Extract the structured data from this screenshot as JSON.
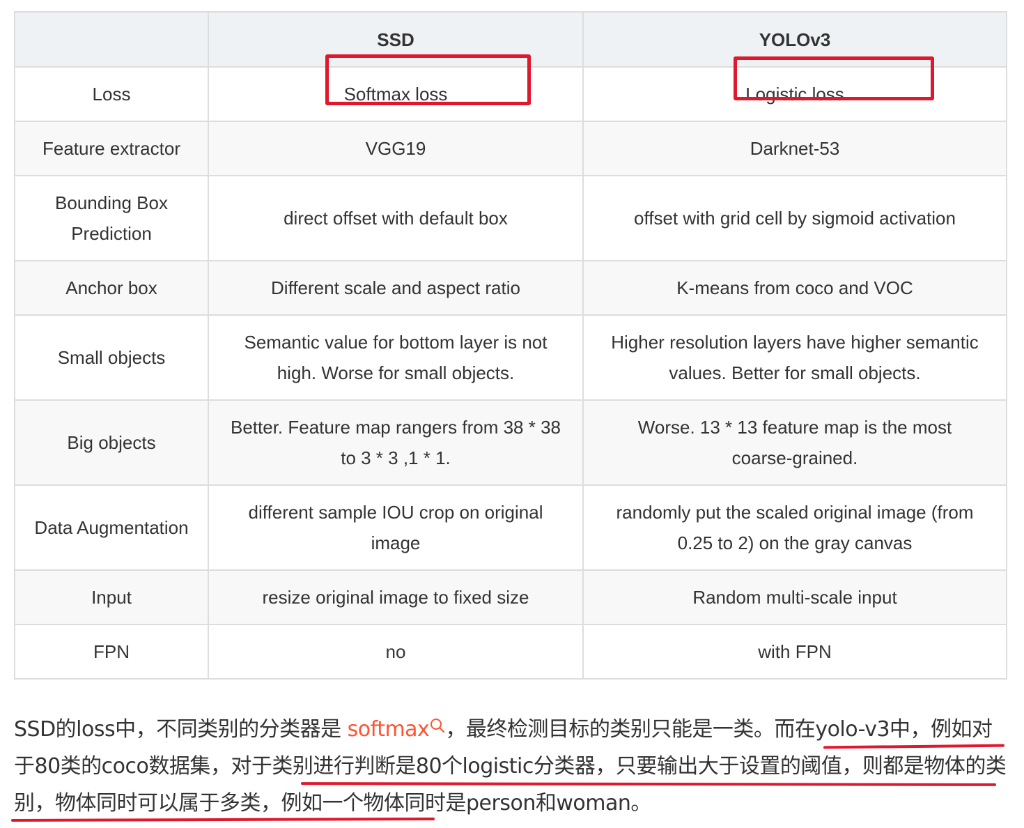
{
  "table": {
    "headers": [
      "",
      "SSD",
      "YOLOv3"
    ],
    "rows": [
      {
        "label": "Loss",
        "ssd": "Softmax loss",
        "yolo": "Logistic loss"
      },
      {
        "label": "Feature extractor",
        "ssd": "VGG19",
        "yolo": "Darknet-53"
      },
      {
        "label": "Bounding Box Prediction",
        "ssd": "direct offset with default box",
        "yolo": "offset with grid cell by sigmoid activation"
      },
      {
        "label": "Anchor box",
        "ssd": "Different scale and aspect ratio",
        "yolo": "K-means from coco and VOC"
      },
      {
        "label": "Small objects",
        "ssd": "Semantic value for bottom layer is not high. Worse for small objects.",
        "yolo": "Higher resolution layers have higher semantic values. Better for small objects."
      },
      {
        "label": "Big objects",
        "ssd": "Better. Feature map rangers from 38 * 38 to 3 * 3 ,1 * 1.",
        "yolo": "Worse. 13 * 13 feature map is the most coarse-grained."
      },
      {
        "label": "Data Augmentation",
        "ssd": "different sample IOU crop on original image",
        "yolo": "randomly put the scaled original image (from 0.25 to 2) on the gray canvas"
      },
      {
        "label": "Input",
        "ssd": "resize original image to fixed size",
        "yolo": "Random multi-scale input"
      },
      {
        "label": "FPN",
        "ssd": "no",
        "yolo": "with FPN"
      }
    ]
  },
  "paragraph": {
    "p1": "SSD的loss中，不同类别的分类器是 ",
    "keyword": "softmax",
    "p2": "，最终检测目标的类别只能是一类。",
    "p3": "而在yolo-v3中，",
    "p4": "例如对于80类的coco数据集，",
    "p5": "对于类别进行判断是80个logistic分类器，只要输出大于设置的阈值，则",
    "p6": "都是物体的类别，物体同时可以属于多类，",
    "p7": "例如一个物体同时是person和woman。"
  },
  "colors": {
    "header_bg": "#eef2f5",
    "border": "#dddddd",
    "text": "#333333",
    "highlight_red": "#e0182d",
    "keyword_orange": "#fc5531"
  }
}
